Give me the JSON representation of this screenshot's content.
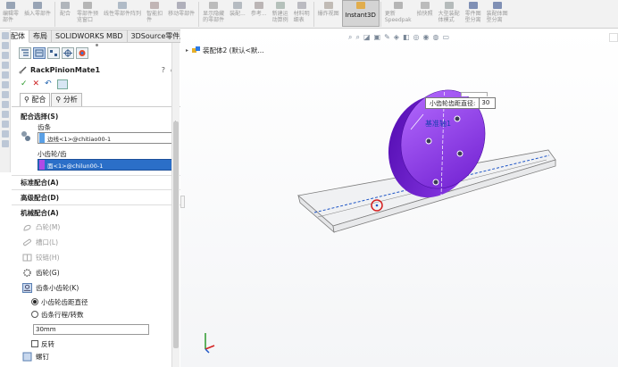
{
  "toolbar": {
    "buttons": [
      {
        "label": "编辑零\n部件"
      },
      {
        "label": "插入零部件"
      },
      {
        "label": "配合"
      },
      {
        "label": "零部件预\n览窗口"
      },
      {
        "label": "线性零部件阵列"
      },
      {
        "label": "智能扣\n件"
      },
      {
        "label": "移动零部件"
      },
      {
        "label": "显示隐藏\n的零部件"
      },
      {
        "label": "装配..."
      },
      {
        "label": "参考..."
      },
      {
        "label": "新建运\n动算例"
      },
      {
        "label": "材料明\n细表"
      },
      {
        "label": "爆炸视图"
      },
      {
        "label": "Instant3D"
      },
      {
        "label": "更新\nSpeedpak"
      },
      {
        "label": "拍快照"
      },
      {
        "label": "大型装配\n体模式"
      },
      {
        "label": "零件图\n型分离"
      },
      {
        "label": "装配体图\n型分离"
      }
    ]
  },
  "tabs": [
    {
      "label": "装配体"
    },
    {
      "label": "布局"
    },
    {
      "label": "SOLIDWORKS MBD"
    },
    {
      "label": "3DSource零件库"
    }
  ],
  "pm": {
    "title": "RackPinionMate1",
    "help_q": "?",
    "help_r": "◎",
    "subtabs": [
      "配合",
      "分析"
    ],
    "selections": {
      "header": "配合选择(S)",
      "rack_label": "齿条",
      "rack_value": "边线<1>@chitiao00-1",
      "pinion_label": "小齿轮/齿",
      "pinion_value": "面<1>@chilun00-1"
    },
    "standard": "标准配合(A)",
    "advanced": "高级配合(D)",
    "mechanical": {
      "header": "机械配合(A)",
      "items": [
        {
          "label": "凸轮(M)",
          "state": "disabled"
        },
        {
          "label": "槽口(L)",
          "state": "disabled"
        },
        {
          "label": "铰链(H)",
          "state": "disabled"
        },
        {
          "label": "齿轮(G)",
          "state": "enabled"
        },
        {
          "label": "齿条小齿轮(K)",
          "state": "picked"
        }
      ],
      "opt_diameter": "小齿轮齿距直径",
      "opt_travel": "齿条行程/转数",
      "value": "30mm",
      "reverse": "反转",
      "next_item": "螺钉"
    }
  },
  "viewport": {
    "tree_label": "装配体2 (默认<默...",
    "callout_label": "小齿轮齿距直径:",
    "callout_value": "30",
    "ref_label": "基准轴1",
    "colors": {
      "gear": "#8a2be2",
      "rack_edge": "#7d7d7d",
      "selected_edge": "#1f56c6",
      "marker": "#d42020"
    }
  }
}
